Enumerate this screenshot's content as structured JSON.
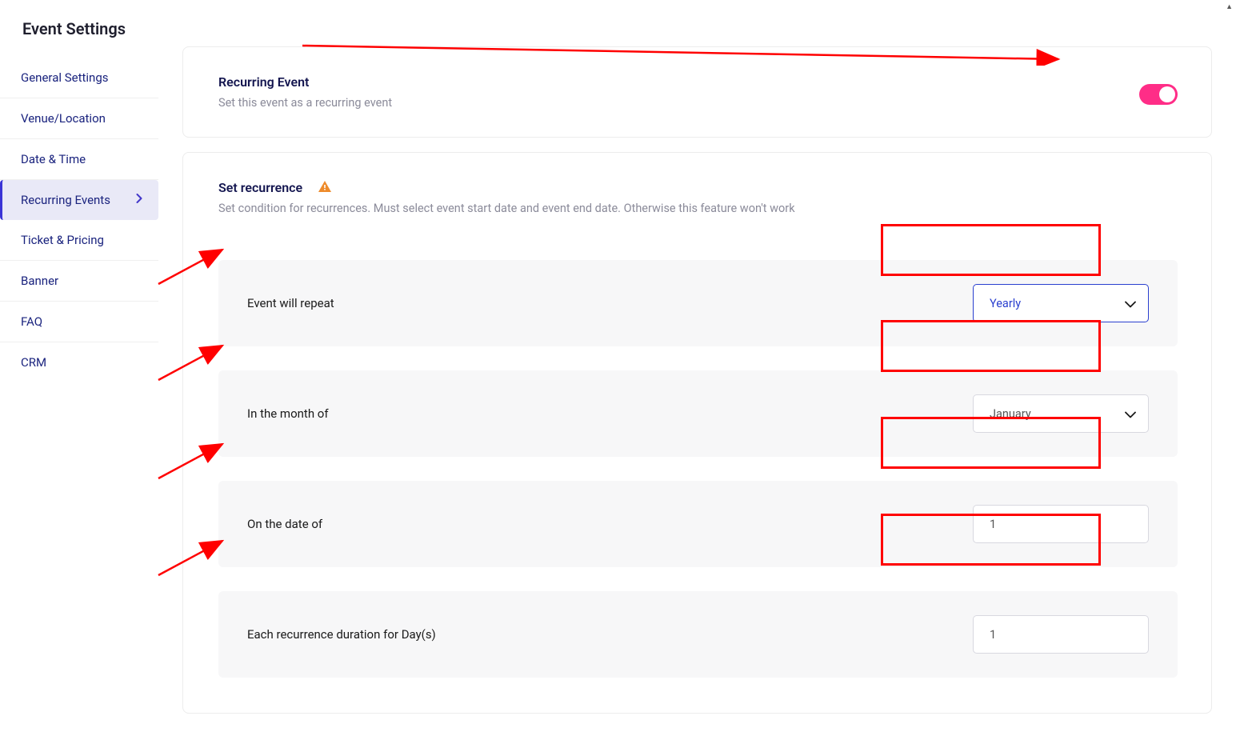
{
  "page": {
    "title": "Event Settings"
  },
  "sidebar": {
    "items": [
      {
        "label": "General Settings"
      },
      {
        "label": "Venue/Location"
      },
      {
        "label": "Date & Time"
      },
      {
        "label": "Recurring Events"
      },
      {
        "label": "Ticket & Pricing"
      },
      {
        "label": "Banner"
      },
      {
        "label": "FAQ"
      },
      {
        "label": "CRM"
      }
    ]
  },
  "recurring_card": {
    "title": "Recurring Event",
    "subtitle": "Set this event as a recurring event",
    "toggle_on": true
  },
  "recurrence_card": {
    "title": "Set recurrence",
    "subtitle": "Set condition for recurrences. Must select event start date and event end date. Otherwise this feature won't work",
    "rows": [
      {
        "label": "Event will repeat",
        "value": "Yearly",
        "type": "select",
        "highlighted": true
      },
      {
        "label": "In the month of",
        "value": "January",
        "type": "select",
        "highlighted": false
      },
      {
        "label": "On the date of",
        "value": "1",
        "type": "input"
      },
      {
        "label": "Each recurrence duration for Day(s)",
        "value": "1",
        "type": "input"
      }
    ]
  },
  "annotations": {
    "color": "#ff0000"
  }
}
